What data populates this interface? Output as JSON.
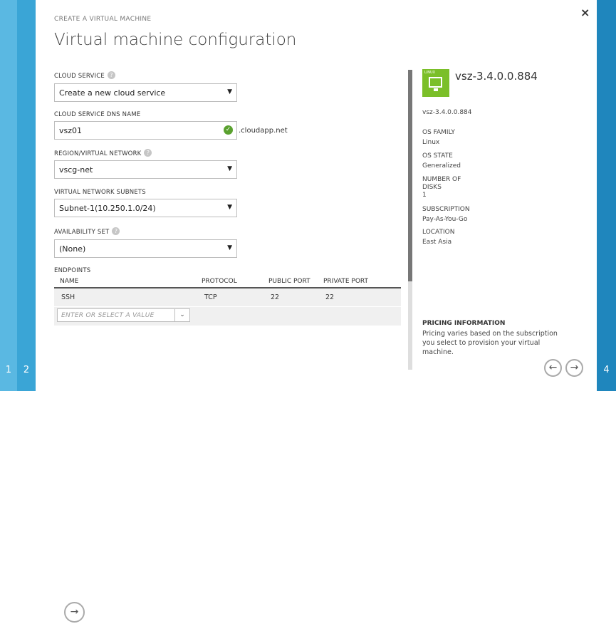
{
  "steps": {
    "step1": "1",
    "step2": "2",
    "step4": "4"
  },
  "header": {
    "kicker": "CREATE A VIRTUAL MACHINE",
    "title": "Virtual machine configuration",
    "close_icon": "×"
  },
  "form": {
    "cloud_service_label": "CLOUD SERVICE",
    "cloud_service_value": "Create a new cloud service",
    "dns_label": "CLOUD SERVICE DNS NAME",
    "dns_value": "vsz01",
    "dns_suffix": ".cloudapp.net",
    "region_label": "REGION/VIRTUAL NETWORK",
    "region_value": "vscg-net",
    "subnets_label": "VIRTUAL NETWORK SUBNETS",
    "subnets_value": "Subnet-1(10.250.1.0/24)",
    "availability_label": "AVAILABILITY SET",
    "availability_value": "(None)",
    "help_glyph": "?"
  },
  "endpoints": {
    "label": "ENDPOINTS",
    "columns": [
      "NAME",
      "PROTOCOL",
      "PUBLIC PORT",
      "PRIVATE PORT"
    ],
    "rows": [
      {
        "name": "SSH",
        "protocol": "TCP",
        "public_port": "22",
        "private_port": "22"
      }
    ],
    "add_placeholder": "ENTER OR SELECT A VALUE"
  },
  "vm_summary": {
    "icon": "linux-vm-icon",
    "icon_tag": "LINUX",
    "name": "vsz-3.4.0.0.884",
    "image_name": "vsz-3.4.0.0.884",
    "os_family_label": "OS FAMILY",
    "os_family": "Linux",
    "os_state_label": "OS STATE",
    "os_state": "Generalized",
    "disks_label_1": "NUMBER OF",
    "disks_label_2": "DISKS",
    "disks": "1",
    "subscription_label": "SUBSCRIPTION",
    "subscription": "Pay-As-You-Go",
    "location_label": "LOCATION",
    "location": "East Asia",
    "pricing_title": "PRICING INFORMATION",
    "pricing_text": "Pricing varies based on the subscription you select to provision your virtual machine."
  },
  "nav": {
    "back_icon": "arrow-left-icon",
    "next_icon": "arrow-right-icon"
  },
  "colors": {
    "step1": "#5ab8e2",
    "step2": "#3aa5d6",
    "step4": "#1f86bd",
    "vm_icon": "#7bbf29",
    "check": "#5aa12f"
  }
}
